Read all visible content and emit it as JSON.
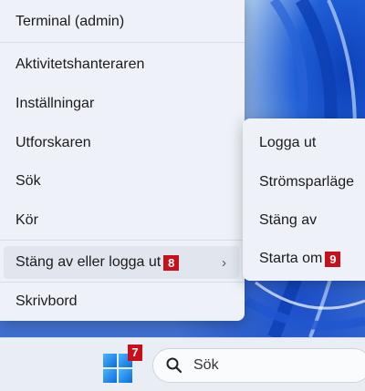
{
  "main_menu": {
    "items": [
      {
        "label": "Terminal (admin)"
      },
      {
        "label": "Aktivitetshanteraren"
      },
      {
        "label": "Inställningar"
      },
      {
        "label": "Utforskaren"
      },
      {
        "label": "Sök"
      },
      {
        "label": "Kör"
      },
      {
        "label": "Stäng av eller logga ut",
        "badge": "8",
        "chevron": "›"
      },
      {
        "label": "Skrivbord"
      }
    ]
  },
  "power_submenu": {
    "items": [
      {
        "label": "Logga ut"
      },
      {
        "label": "Strömsparläge"
      },
      {
        "label": "Stäng av"
      },
      {
        "label": "Starta om",
        "badge": "9"
      }
    ]
  },
  "taskbar": {
    "start_badge": "7",
    "search_label": "Sök"
  },
  "colors": {
    "badge": "#c8101c",
    "menu_bg": "#eef2f8"
  }
}
